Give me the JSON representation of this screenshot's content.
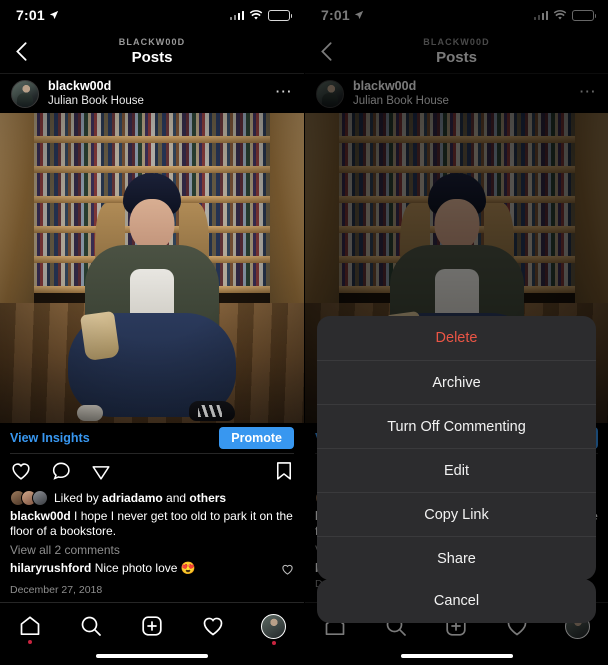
{
  "status_bar": {
    "time": "7:01",
    "location_icon": "location-arrow-icon",
    "signal_icon": "cellular-bars-icon",
    "wifi_icon": "wifi-icon",
    "battery_icon": "battery-icon",
    "battery_color": "#f5c518"
  },
  "nav": {
    "back_icon": "chevron-left-icon",
    "subtitle": "BLACKW00D",
    "title": "Posts"
  },
  "post": {
    "avatar": "user-avatar",
    "username": "blackw00d",
    "location": "Julian Book House",
    "more_icon": "more-options-icon",
    "image_alt": "woman-sitting-on-bookstore-floor"
  },
  "insights": {
    "link_label": "View Insights",
    "link_color": "#3897f0",
    "promote_label": "Promote",
    "promote_color": "#3897f0"
  },
  "actions": {
    "like_icon": "heart-icon",
    "comment_icon": "comment-icon",
    "share_icon": "share-paper-plane-icon",
    "save_icon": "bookmark-icon"
  },
  "likes": {
    "prefix": "Liked by ",
    "username": "adriadamo",
    "middle": " and ",
    "suffix": "others"
  },
  "caption": {
    "username": "blackw00d",
    "text": " I hope I never get too old to park it on the floor of a bookstore."
  },
  "view_comments": "View all 2 comments",
  "comment": {
    "username": "hilaryrushford",
    "text": " Nice photo love ",
    "emoji": "😍",
    "heart_icon": "heart-icon"
  },
  "date": "December 27, 2018",
  "tabbar": {
    "items": [
      {
        "name": "home-icon",
        "badge": true
      },
      {
        "name": "search-icon",
        "badge": false
      },
      {
        "name": "add-post-icon",
        "badge": false
      },
      {
        "name": "activity-heart-icon",
        "badge": false
      },
      {
        "name": "profile-avatar-icon",
        "badge": true
      }
    ]
  },
  "action_sheet": {
    "items": [
      {
        "label": "Delete",
        "destructive": true
      },
      {
        "label": "Archive",
        "destructive": false
      },
      {
        "label": "Turn Off Commenting",
        "destructive": false
      },
      {
        "label": "Edit",
        "destructive": false
      },
      {
        "label": "Copy Link",
        "destructive": false
      },
      {
        "label": "Share",
        "destructive": false
      }
    ],
    "cancel_label": "Cancel"
  }
}
